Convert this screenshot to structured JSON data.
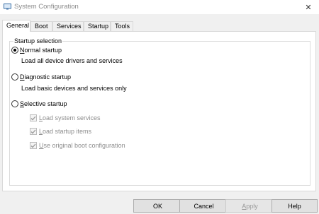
{
  "window": {
    "title": "System Configuration",
    "close_glyph": "✕"
  },
  "tabs": [
    {
      "label": "General",
      "active": true
    },
    {
      "label": "Boot",
      "active": false
    },
    {
      "label": "Services",
      "active": false
    },
    {
      "label": "Startup",
      "active": false
    },
    {
      "label": "Tools",
      "active": false
    }
  ],
  "startup_selection": {
    "legend": "Startup selection",
    "options": [
      {
        "label_first": "N",
        "label_rest": "ormal startup",
        "description": "Load all device drivers and services",
        "selected": true
      },
      {
        "label_first": "D",
        "label_rest": "iagnostic startup",
        "description": "Load basic devices and services only",
        "selected": false
      },
      {
        "label_first": "S",
        "label_rest": "elective startup",
        "description": "",
        "selected": false
      }
    ],
    "selective_items": [
      {
        "label_first": "L",
        "label_rest": "oad system services",
        "checked": true,
        "enabled": false
      },
      {
        "label_first": "L",
        "label_rest": "oad startup items",
        "checked": true,
        "enabled": false
      },
      {
        "label_first": "U",
        "label_rest": "se original boot configuration",
        "checked": true,
        "enabled": false
      }
    ]
  },
  "buttons": {
    "ok": "OK",
    "cancel": "Cancel",
    "apply_first": "A",
    "apply_rest": "pply",
    "help": "Help"
  }
}
